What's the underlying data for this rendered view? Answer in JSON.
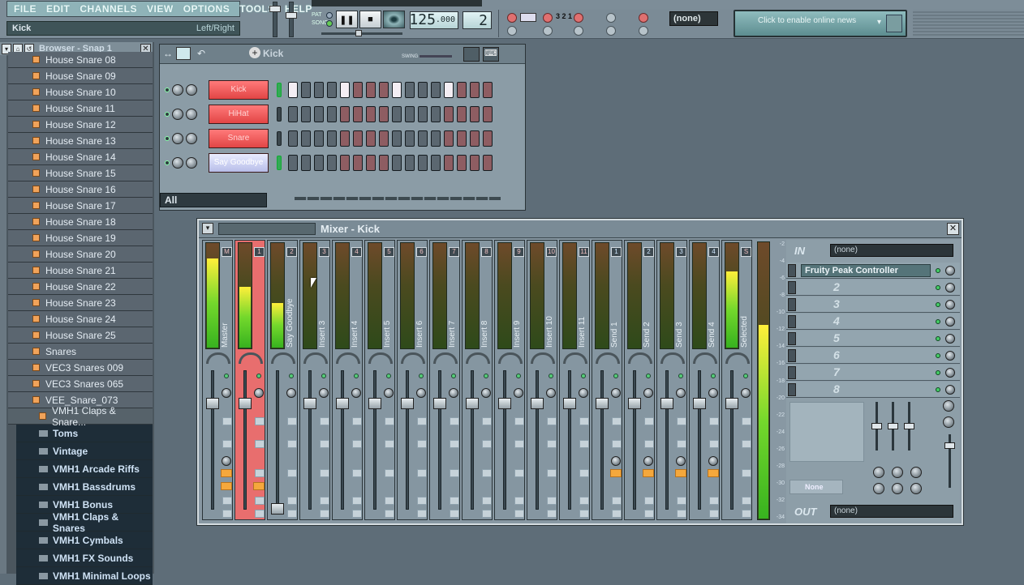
{
  "menu": {
    "items": [
      "FILE",
      "EDIT",
      "CHANNELS",
      "VIEW",
      "OPTIONS",
      "TOOLS",
      "HELP"
    ]
  },
  "hint_bar": {
    "left": "Kick",
    "right": "Left/Right"
  },
  "transport": {
    "pat_label": "PAT",
    "song_label": "SONG",
    "pause_icon": "pause-icon",
    "stop_icon": "stop-icon",
    "record_icon": "record-icon",
    "tempo_int": "125",
    "tempo_frac": ".000",
    "pattern": "2"
  },
  "top_dropdown": "(none)",
  "news": {
    "text": "Click to enable online news"
  },
  "browser": {
    "title": "Browser - Snap 1",
    "files": [
      "House Snare 08",
      "House Snare 09",
      "House Snare 10",
      "House Snare 11",
      "House Snare 12",
      "House Snare 13",
      "House Snare 14",
      "House Snare 15",
      "House Snare 16",
      "House Snare 17",
      "House Snare 18",
      "House Snare 19",
      "House Snare 20",
      "House Snare 21",
      "House Snare 22",
      "House Snare 23",
      "House Snare 24",
      "House Snare 25",
      "Snares",
      "VEC3 Snares 009",
      "VEC3 Snares 065",
      "VEE_Snare_073"
    ],
    "selected_file": "VMH1 Claps & Snare...",
    "folders": [
      "Toms",
      "Vintage",
      "VMH1 Arcade Riffs",
      "VMH1 Bassdrums",
      "VMH1 Bonus",
      "VMH1 Claps & Snares",
      "VMH1 Cymbals",
      "VMH1 FX Sounds",
      "VMH1 Minimal Loops"
    ]
  },
  "channel_rack": {
    "pattern_name": "Kick",
    "swing_label": "SWING",
    "filter": "All",
    "channels": [
      {
        "name": "Kick",
        "color": "red",
        "selected": true,
        "steps": [
          1,
          0,
          0,
          0,
          1,
          0,
          0,
          0,
          1,
          0,
          0,
          0,
          1,
          0,
          0,
          0
        ]
      },
      {
        "name": "HiHat",
        "color": "red",
        "selected": false,
        "steps": [
          0,
          0,
          0,
          0,
          0,
          0,
          0,
          0,
          0,
          0,
          0,
          0,
          0,
          0,
          0,
          0
        ]
      },
      {
        "name": "Snare",
        "color": "red",
        "selected": false,
        "steps": [
          0,
          0,
          0,
          0,
          0,
          0,
          0,
          0,
          0,
          0,
          0,
          0,
          0,
          0,
          0,
          0
        ]
      },
      {
        "name": "Say Goodbye",
        "color": "blue",
        "selected": true,
        "steps": [
          0,
          0,
          0,
          0,
          0,
          0,
          0,
          0,
          0,
          0,
          0,
          0,
          0,
          0,
          0,
          0
        ]
      }
    ]
  },
  "mixer": {
    "title": "Mixer - Kick",
    "strips": [
      {
        "label": "Master",
        "badge": "M",
        "level": 0.85,
        "type": "master"
      },
      {
        "label": "",
        "badge": "1",
        "level": 0.58,
        "type": "ins",
        "selected": true
      },
      {
        "label": "Say Goodbye",
        "badge": "2",
        "level": 0.42,
        "type": "ins"
      },
      {
        "label": "Insert 3",
        "badge": "3",
        "level": 0,
        "type": "ins"
      },
      {
        "label": "Insert 4",
        "badge": "4",
        "level": 0,
        "type": "ins"
      },
      {
        "label": "Insert 5",
        "badge": "5",
        "level": 0,
        "type": "ins"
      },
      {
        "label": "Insert 6",
        "badge": "6",
        "level": 0,
        "type": "ins"
      },
      {
        "label": "Insert 7",
        "badge": "7",
        "level": 0,
        "type": "ins"
      },
      {
        "label": "Insert 8",
        "badge": "8",
        "level": 0,
        "type": "ins"
      },
      {
        "label": "Insert 9",
        "badge": "9",
        "level": 0,
        "type": "ins"
      },
      {
        "label": "Insert 10",
        "badge": "10",
        "level": 0,
        "type": "ins"
      },
      {
        "label": "Insert 11",
        "badge": "11",
        "level": 0,
        "type": "ins"
      },
      {
        "label": "Send 1",
        "badge": "1",
        "level": 0,
        "type": "snd"
      },
      {
        "label": "Send 2",
        "badge": "2",
        "level": 0,
        "type": "snd"
      },
      {
        "label": "Send 3",
        "badge": "3",
        "level": 0,
        "type": "snd"
      },
      {
        "label": "Send 4",
        "badge": "4",
        "level": 0,
        "type": "snd"
      },
      {
        "label": "Selected",
        "badge": "S",
        "level": 0.72,
        "type": "sel"
      }
    ],
    "master_level": 0.7,
    "scale": [
      "-2",
      "-4",
      "-6",
      "-8",
      "-10",
      "-12",
      "-14",
      "-16",
      "-18",
      "-20",
      "-22",
      "-24",
      "-26",
      "-28",
      "-30",
      "-32",
      "-34"
    ],
    "in_label": "IN",
    "in_value": "(none)",
    "out_label": "OUT",
    "out_value": "(none)",
    "fx_slots": [
      "Fruity Peak Controller",
      "2",
      "3",
      "4",
      "5",
      "6",
      "7",
      "8"
    ],
    "eq_preset": "None"
  }
}
